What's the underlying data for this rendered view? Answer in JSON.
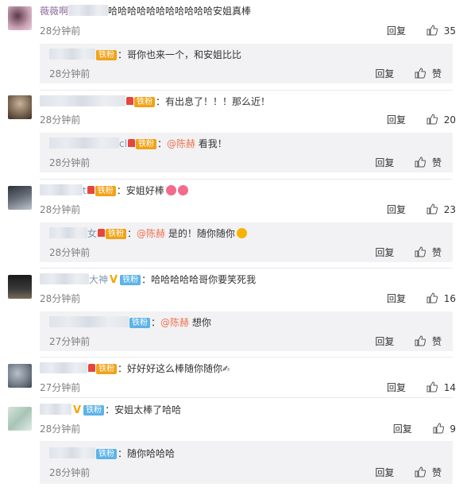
{
  "comments": [
    {
      "text": "哈哈哈哈哈哈哈哈哈哈哈安姐真棒",
      "name_visible": "薇薇啊",
      "time": "28分钟前",
      "reply_label": "回复",
      "likes": "35",
      "reply": {
        "badge": "铁粉",
        "text": "：哥你也来一个，和安姐比比",
        "time": "28分钟前",
        "reply_label": "回复",
        "like_label": "赞"
      }
    },
    {
      "badge": "铁粉",
      "text": "：有出息了！！！那么近！",
      "time": "28分钟前",
      "reply_label": "回复",
      "likes": "20",
      "reply": {
        "name_suffix": "cl",
        "badge": "铁粉",
        "mention": "@陈赫",
        "text": " 看我！",
        "time": "28分钟前",
        "reply_label": "回复",
        "like_label": "赞"
      }
    },
    {
      "name_suffix": "t",
      "badge": "铁粉",
      "text": "：安姐好棒",
      "time": "28分钟前",
      "reply_label": "回复",
      "likes": "23",
      "reply": {
        "name_suffix": "女",
        "badge": "铁粉",
        "mention": "@陈赫",
        "text": " 是的！随你随你",
        "time": "28分钟前",
        "reply_label": "回复",
        "like_label": "赞"
      }
    },
    {
      "name_suffix": "大神",
      "badge": "铁粉",
      "text": "：哈哈哈哈哈哥你要笑死我",
      "time": "28分钟前",
      "reply_label": "回复",
      "likes": "16",
      "reply": {
        "badge": "铁粉",
        "mention": "@陈赫",
        "text": " 想你",
        "time": "27分钟前",
        "reply_label": "回复",
        "like_label": "赞"
      }
    },
    {
      "badge": "铁粉",
      "text": "：好好好这么棒随你随你",
      "time": "27分钟前",
      "reply_label": "回复",
      "likes": "14"
    },
    {
      "badge": "铁粉",
      "text": "：安姐太棒了哈哈",
      "time": "28分钟前",
      "reply_label": "回复",
      "likes": "9",
      "reply": {
        "badge": "铁粉",
        "text": "：随你哈哈哈",
        "time": "28分钟前",
        "reply_label": "回复",
        "like_label": "赞"
      }
    }
  ],
  "colors": {
    "badge_orange": "#f0a318",
    "badge_blue": "#5cb3e8",
    "mention": "#eb7350",
    "time": "#808080",
    "reply_bg": "#f2f2f5"
  }
}
